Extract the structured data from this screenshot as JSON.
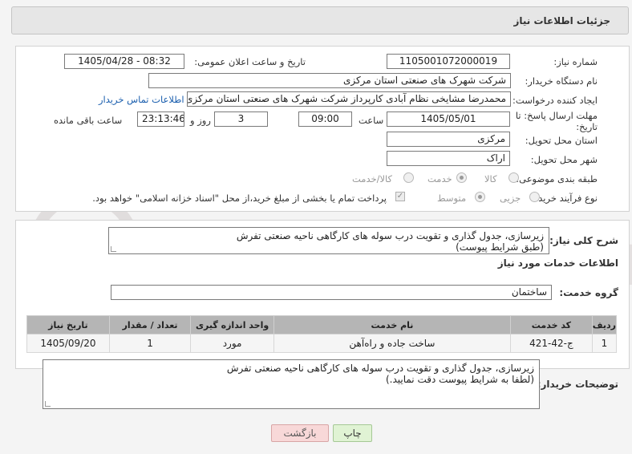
{
  "header": {
    "title": "جزئیات اطلاعات نیاز"
  },
  "form": {
    "need_number": {
      "label": "شماره نیاز:",
      "value": "1105001072000019"
    },
    "announce_datetime": {
      "label": "تاریخ و ساعت اعلان عمومی:",
      "value": "1405/04/28 - 08:32"
    },
    "buyer_org": {
      "label": "نام دستگاه خریدار:",
      "value": "شرکت شهرک های صنعتی استان مرکزی"
    },
    "requester": {
      "label": "ایجاد کننده درخواست:",
      "value": "محمدرضا مشایخی نظام آبادی کارپرداز شرکت شهرک های صنعتی استان مرکزی"
    },
    "buyer_contact_link": "اطلاعات تماس خریدار",
    "deadline": {
      "label_line1": "مهلت ارسال پاسخ: تا",
      "label_line2": "تاریخ:",
      "date": "1405/05/01",
      "time_label": "ساعت",
      "time": "09:00",
      "days": "3",
      "days_label": "روز و",
      "remaining": "23:13:46",
      "remaining_label": "ساعت باقی مانده"
    },
    "province": {
      "label": "استان محل تحویل:",
      "value": "مرکزی"
    },
    "city": {
      "label": "شهر محل تحویل:",
      "value": "اراک"
    },
    "category": {
      "label": "طبقه بندی موضوعی:",
      "options": [
        "کالا",
        "خدمت",
        "کالا/خدمت"
      ],
      "selected": "خدمت"
    },
    "process_type": {
      "label": "نوع فرآیند خرید :",
      "options": [
        "جزیی",
        "متوسط"
      ],
      "selected": "متوسط",
      "payment_note": "پرداخت تمام یا بخشی از مبلغ خرید،از محل \"اسناد خزانه اسلامی\" خواهد بود."
    }
  },
  "summary": {
    "label": "شرح کلی نیاز:",
    "line1": "زیرسازی، جدول گذاری و تقویت درب سوله های کارگاهی ناحیه صنعتی تفرش",
    "line2": "(طبق شرایط پیوست)"
  },
  "services": {
    "section_title": "اطلاعات خدمات مورد نیاز",
    "group_label": "گروه خدمت:",
    "group_value": "ساختمان",
    "columns": [
      "ردیف",
      "کد خدمت",
      "نام خدمت",
      "واحد اندازه گیری",
      "تعداد / مقدار",
      "تاریخ نیاز"
    ],
    "rows": [
      {
        "row": "1",
        "code": "ج-42-421",
        "name": "ساخت جاده و راه‌آهن",
        "unit": "مورد",
        "qty": "1",
        "date": "1405/09/20"
      }
    ]
  },
  "buyer_notes": {
    "label": "توضیحات خریدار:",
    "line1": "زیرسازی، جدول گذاری و تقویت درب سوله های کارگاهی ناحیه صنعتی تفرش",
    "line2": "(لطفا به شرایط پیوست دقت نمایید.)"
  },
  "buttons": {
    "print": "چاپ",
    "back": "بازگشت"
  },
  "watermark": {
    "text": "AriaTender.net"
  },
  "colors": {
    "link": "#1b5fae",
    "table_header": "#b5b5b5",
    "back_button": "#f8d8d8",
    "print_button": "#e0f3d4",
    "watermark": "#e0dcdc"
  }
}
